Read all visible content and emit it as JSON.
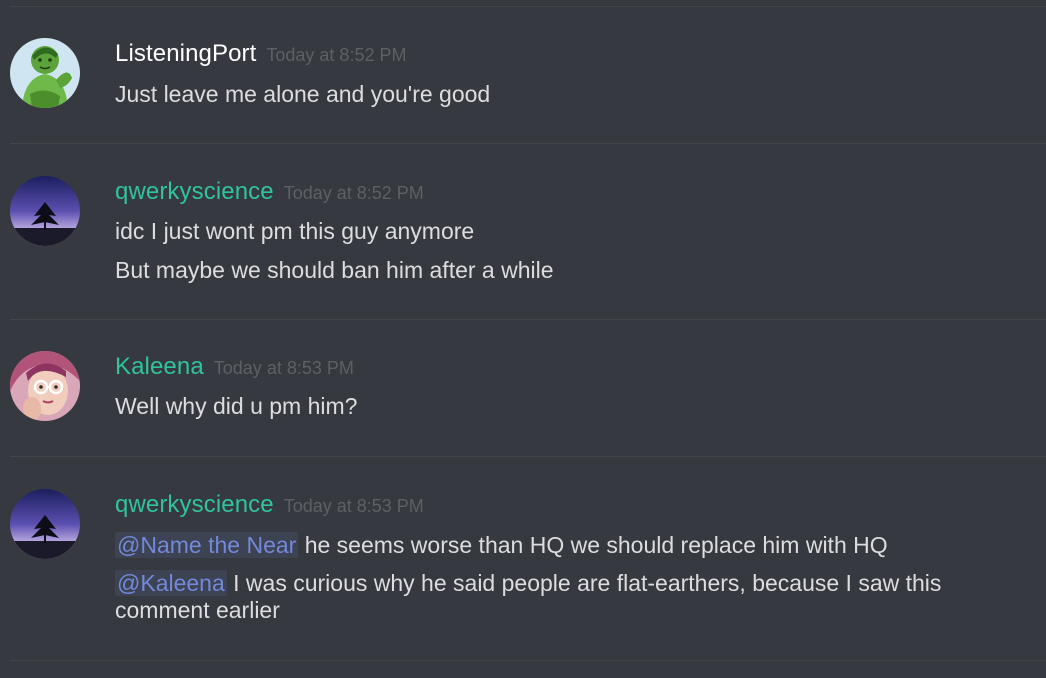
{
  "colors": {
    "background": "#36393f",
    "username_white": "#ffffff",
    "username_green": "#2fc49a",
    "timestamp": "#5d6065",
    "message_text": "#dcddde",
    "mention": "#7289da"
  },
  "messages": [
    {
      "username": "ListeningPort",
      "username_color": "#ffffff",
      "timestamp": "Today at 8:52 PM",
      "avatar_icon": "green-giant-avatar-icon",
      "lines": [
        "Just leave me alone and you're good"
      ]
    },
    {
      "username": "qwerkyscience",
      "username_color": "#2fc49a",
      "timestamp": "Today at 8:52 PM",
      "avatar_icon": "tree-night-sky-avatar-icon",
      "lines": [
        "idc I just wont pm this guy anymore",
        "But maybe we should ban him after a while"
      ]
    },
    {
      "username": "Kaleena",
      "username_color": "#2fc49a",
      "timestamp": "Today at 8:53 PM",
      "avatar_icon": "girl-glasses-avatar-icon",
      "lines": [
        "Well why did u pm him?"
      ]
    },
    {
      "username": "qwerkyscience",
      "username_color": "#2fc49a",
      "timestamp": "Today at 8:53 PM",
      "avatar_icon": "tree-night-sky-avatar-icon",
      "line1_mention": "@Name the Near",
      "line1_text": " he seems worse than HQ we should replace him with HQ",
      "line2_mention": "@Kaleena",
      "line2_text": " I was curious why he said people are flat-earthers, because I saw this comment earlier"
    }
  ]
}
